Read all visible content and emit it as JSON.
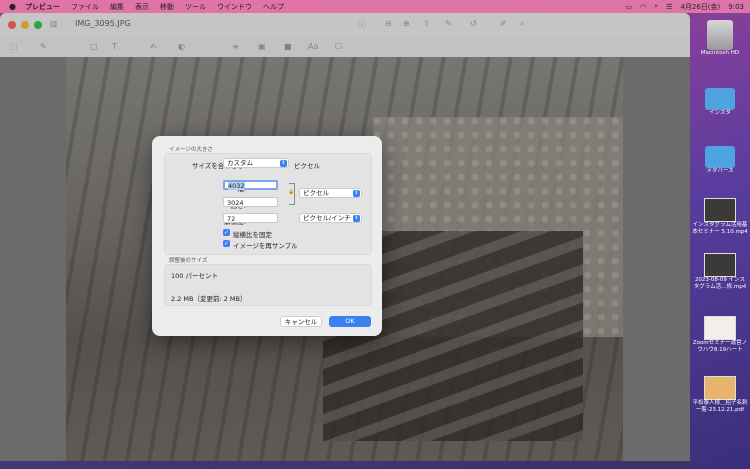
{
  "menubar": {
    "apple_icon": "apple-icon",
    "app_name": "プレビュー",
    "items": [
      "ファイル",
      "編集",
      "表示",
      "移動",
      "ツール",
      "ウインドウ",
      "ヘルプ"
    ],
    "status": {
      "date": "4月26日(金)",
      "time": "9:03"
    }
  },
  "window": {
    "title": "IMG_3095.JPG"
  },
  "dialog": {
    "section_title": "イメージの大きさ",
    "fit_label": "サイズを合わせる:",
    "fit_value": "カスタム",
    "fit_unit": "ピクセル",
    "width_label": "幅:",
    "width_value": "4032",
    "height_label": "高さ:",
    "height_value": "3024",
    "size_unit_value": "ピクセル",
    "resolution_label": "解像度:",
    "resolution_value": "72",
    "resolution_unit_value": "ピクセル/インチ",
    "keep_ratio_label": "縦横比を固定",
    "keep_ratio_checked": true,
    "resample_label": "イメージを再サンプル",
    "resample_checked": true,
    "result_title": "調整後のサイズ",
    "result_percent": "100 パーセント",
    "result_size": "2.2 MB（変更前: 2 MB）",
    "cancel_label": "キャンセル",
    "ok_label": "OK"
  },
  "desktop_items": [
    {
      "label_lines": [
        "Macintosh HD"
      ],
      "kind": "hdd"
    },
    {
      "label_lines": [
        "インスタ"
      ],
      "kind": "folder"
    },
    {
      "label_lines": [
        "メタバース"
      ],
      "kind": "folder"
    },
    {
      "label_lines": [
        "インスタグラム活用基",
        "本セミナー 5.10.mp4"
      ],
      "kind": "video"
    },
    {
      "label_lines": [
        "2023-08-09 インス",
        "タグラム活…修.mp4"
      ],
      "kind": "video"
    },
    {
      "label_lines": [
        "Zoomセミナー運営ノ",
        "ウハウ8.19ハート"
      ],
      "kind": "doc"
    },
    {
      "label_lines": [
        "平松泰人様＿招子名刺",
        "一覧-23.12.21.pdf"
      ],
      "kind": "doc2"
    }
  ]
}
